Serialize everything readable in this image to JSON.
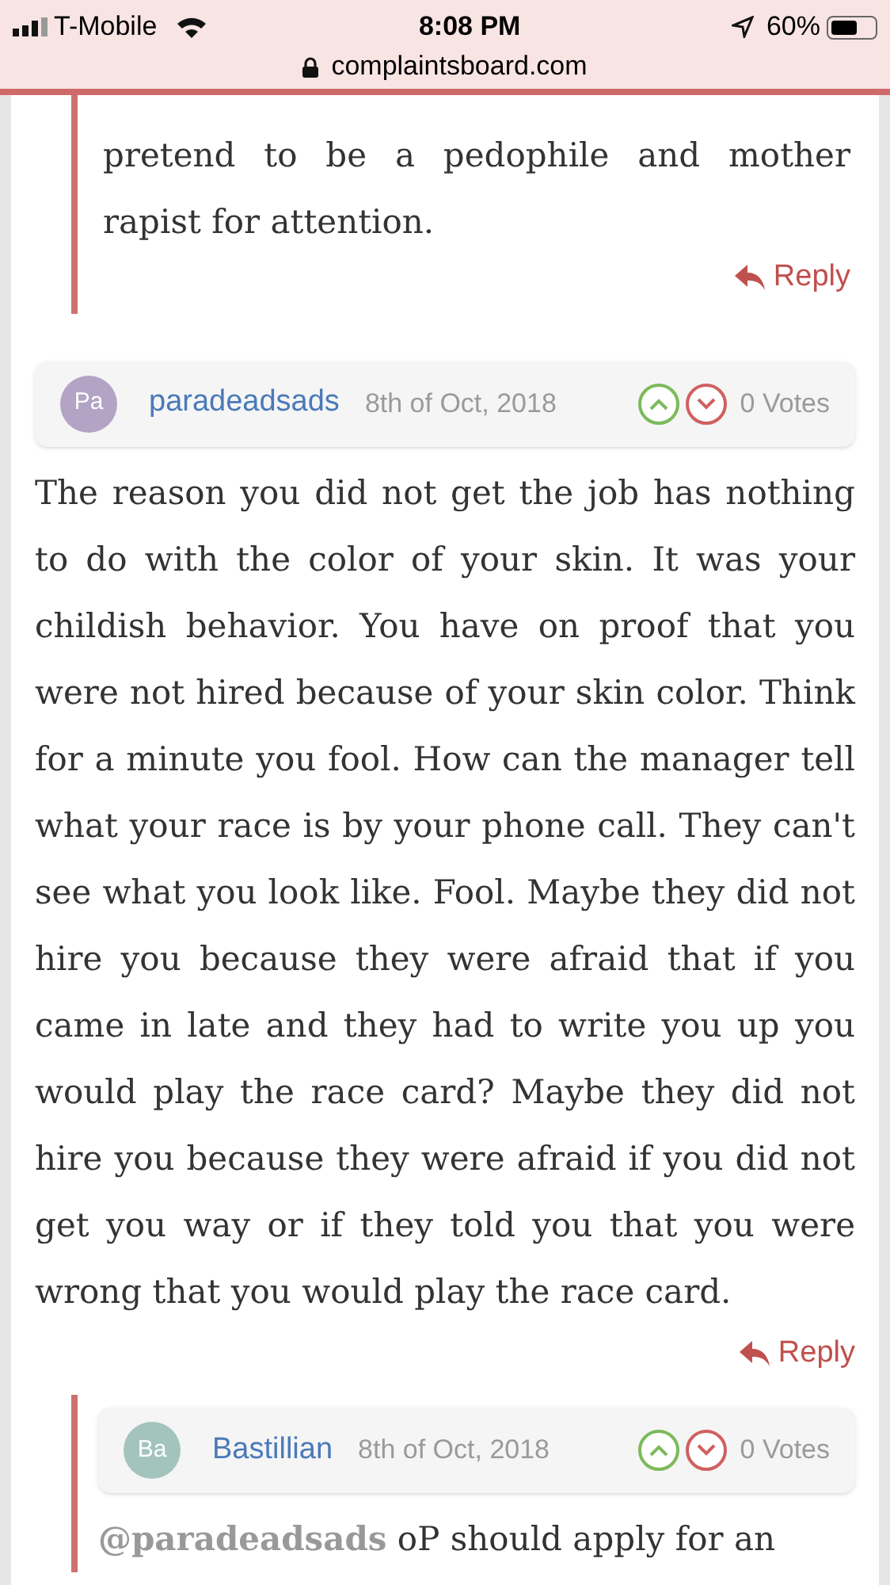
{
  "status_bar": {
    "carrier": "T-Mobile",
    "time": "8:08 PM",
    "battery": "60%"
  },
  "address_bar": {
    "url": "complaintsboard.com"
  },
  "reply_fragment": {
    "text": "pretend to be a pedophile and mother rapist for attention.",
    "reply": "Reply"
  },
  "comments": [
    {
      "initials": "Pa",
      "color": "#b3a3c4",
      "author": "paradeadsads",
      "date": "8th of Oct, 2018",
      "votes": "0 Votes",
      "text": "The reason you did not get the job has nothing to do with the color of your skin. It was your childish behavior. You have on proof that you were not hired because of your skin color. Think for a minute you fool. How can the manager tell what your race is by your phone call. They can't see what you look like. Fool. Maybe they did not hire you because they were afraid that if you came in late and they had to write you up you would play the race card? Maybe they did not hire you because they were afraid if you did not get you way or if they told you that you were wrong that you would play the race card.",
      "reply": "Reply",
      "children": [
        {
          "initials": "Ba",
          "color": "#a3c4bd",
          "author": "Bastillian",
          "date": "8th of Oct, 2018",
          "votes": "0 Votes",
          "mention": "@paradeadsads",
          "text": "oP should apply for an"
        }
      ]
    }
  ]
}
